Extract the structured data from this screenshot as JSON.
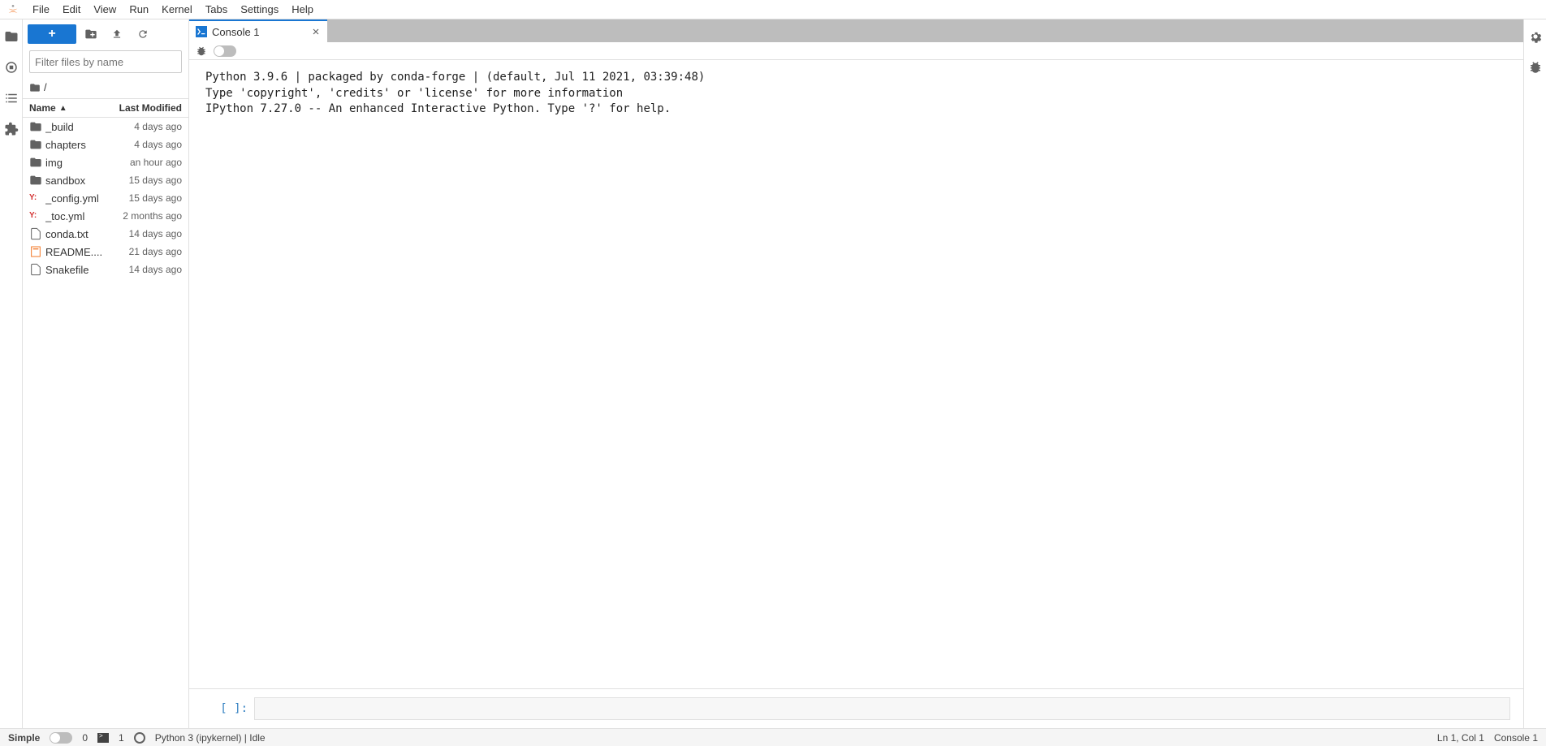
{
  "menu": {
    "items": [
      "File",
      "Edit",
      "View",
      "Run",
      "Kernel",
      "Tabs",
      "Settings",
      "Help"
    ]
  },
  "filebrowser": {
    "filter_placeholder": "Filter files by name",
    "breadcrumb": "/",
    "header_name": "Name",
    "header_modified": "Last Modified",
    "files": [
      {
        "icon": "folder",
        "name": "_build",
        "modified": "4 days ago"
      },
      {
        "icon": "folder",
        "name": "chapters",
        "modified": "4 days ago"
      },
      {
        "icon": "folder",
        "name": "img",
        "modified": "an hour ago"
      },
      {
        "icon": "folder",
        "name": "sandbox",
        "modified": "15 days ago"
      },
      {
        "icon": "yaml",
        "name": "_config.yml",
        "modified": "15 days ago"
      },
      {
        "icon": "yaml",
        "name": "_toc.yml",
        "modified": "2 months ago"
      },
      {
        "icon": "file",
        "name": "conda.txt",
        "modified": "14 days ago"
      },
      {
        "icon": "notebook",
        "name": "README....",
        "modified": "21 days ago"
      },
      {
        "icon": "file",
        "name": "Snakefile",
        "modified": "14 days ago"
      }
    ]
  },
  "tab": {
    "label": "Console 1"
  },
  "console": {
    "banner": "Python 3.9.6 | packaged by conda-forge | (default, Jul 11 2021, 03:39:48) \nType 'copyright', 'credits' or 'license' for more information\nIPython 7.27.0 -- An enhanced Interactive Python. Type '?' for help.",
    "prompt": "[ ]:"
  },
  "status": {
    "simple": "Simple",
    "terminals_count": "0",
    "kernels_count": "1",
    "kernel": "Python 3 (ipykernel) | Idle",
    "cursor": "Ln 1, Col 1",
    "doc": "Console 1"
  }
}
